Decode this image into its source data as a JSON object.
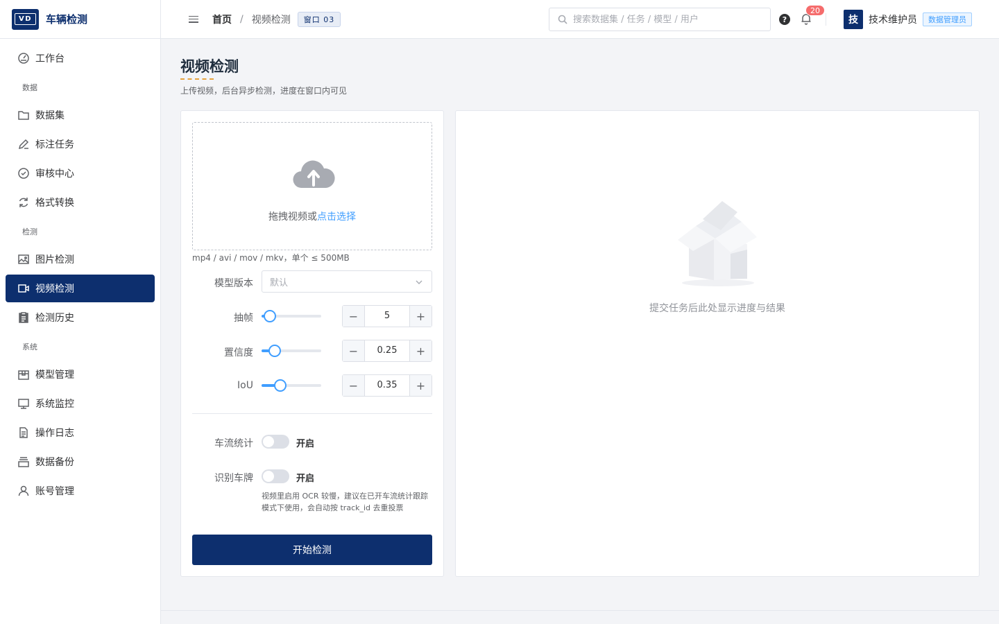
{
  "app": {
    "logo": "VD",
    "title": "车辆检测"
  },
  "sidebar": {
    "items": [
      {
        "label": "工作台"
      },
      {
        "group": "数据"
      },
      {
        "label": "数据集"
      },
      {
        "label": "标注任务"
      },
      {
        "label": "审核中心"
      },
      {
        "label": "格式转换"
      },
      {
        "group": "检测"
      },
      {
        "label": "图片检测"
      },
      {
        "label": "视频检测"
      },
      {
        "label": "检测历史"
      },
      {
        "group": "系统"
      },
      {
        "label": "模型管理"
      },
      {
        "label": "系统监控"
      },
      {
        "label": "操作日志"
      },
      {
        "label": "数据备份"
      },
      {
        "label": "账号管理"
      }
    ],
    "active": "视频检测"
  },
  "header": {
    "breadcrumb": {
      "home": "首页",
      "separator": "/",
      "current": "视频检测",
      "tag": "窗口 03"
    },
    "search": {
      "placeholder": "搜索数据集 / 任务 / 模型 / 用户",
      "value": ""
    },
    "help_glyph": "?",
    "notifications": {
      "count": "20"
    },
    "user": {
      "avatar": "技",
      "name": "技术维护员",
      "role": "数据管理员"
    }
  },
  "page": {
    "title": "视频检测",
    "subtitle": "上传视频，后台异步检测，进度在窗口内可见"
  },
  "upload": {
    "text": "拖拽视频或",
    "link": "点击选择",
    "tip": "mp4 / avi / mov / mkv，单个 ≤ 500MB"
  },
  "form": {
    "model_label": "模型版本",
    "model_placeholder": "默认",
    "params": [
      {
        "label": "抽帧",
        "value": "5",
        "fraction": 0.14
      },
      {
        "label": "置信度",
        "value": "0.25",
        "fraction": 0.22
      },
      {
        "label": "IoU",
        "value": "0.35",
        "fraction": 0.31
      }
    ],
    "stepper_minus": "−",
    "stepper_plus": "+",
    "toggles": [
      {
        "label": "车流统计",
        "state_text": "开启",
        "on": false
      },
      {
        "label": "识别车牌",
        "state_text": "开启",
        "on": false
      }
    ],
    "hint": "视频里启用 OCR 较慢，建议在已开车流统计跟踪模式下使用，会自动按 track_id 去重投票",
    "submit": "开始检测"
  },
  "result": {
    "empty_text": "提交任务后此处显示进度与结果"
  },
  "colors": {
    "brand": "#0d2f6e",
    "accent": "#409eff",
    "badge": "#f56c6c",
    "title_underline": "#e6a23c"
  }
}
